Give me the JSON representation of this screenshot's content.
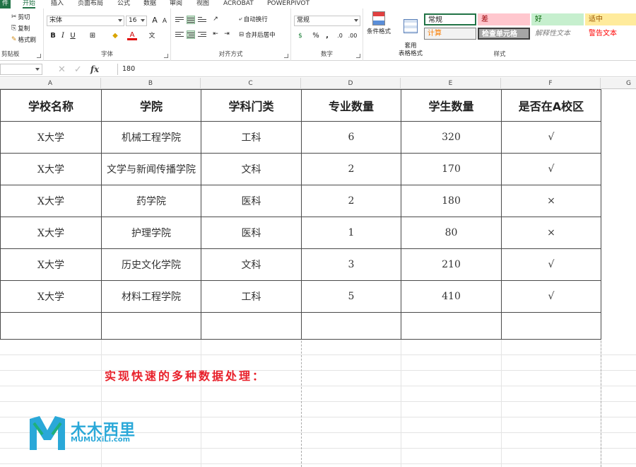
{
  "tabs": [
    "件",
    "开始",
    "插入",
    "页面布局",
    "公式",
    "数据",
    "审阅",
    "视图",
    "ACROBAT",
    "POWERPIVOT"
  ],
  "clipboard": {
    "cut": "剪切",
    "copy": "复制",
    "painter": "格式刷",
    "label": "剪贴板"
  },
  "font": {
    "name": "宋体",
    "size": "16",
    "label": "字体",
    "bold": "B",
    "italic": "I",
    "underline": "U"
  },
  "alignment": {
    "wrap": "自动换行",
    "merge": "合并后居中",
    "label": "对齐方式"
  },
  "number": {
    "format": "常规",
    "percent": "%",
    "comma": ",",
    "label": "数字"
  },
  "styles": {
    "conditional": "条件格式",
    "table": "套用\n表格格式",
    "normal": "常规",
    "bad": "差",
    "good": "好",
    "neutral": "适中",
    "calc": "计算",
    "check": "检查单元格",
    "explain": "解释性文本",
    "warn": "警告文本",
    "label": "样式"
  },
  "formula_bar": {
    "name_box": "",
    "fx": "fx",
    "value": "180"
  },
  "columns": [
    "A",
    "B",
    "C",
    "D",
    "E",
    "F",
    "G"
  ],
  "table": {
    "headers": [
      "学校名称",
      "学院",
      "学科门类",
      "专业数量",
      "学生数量",
      "是否在A校区"
    ],
    "rows": [
      [
        "X大学",
        "机械工程学院",
        "工科",
        "6",
        "320",
        "√"
      ],
      [
        "X大学",
        "文学与新闻传播学院",
        "文科",
        "2",
        "170",
        "√"
      ],
      [
        "X大学",
        "药学院",
        "医科",
        "2",
        "180",
        "×"
      ],
      [
        "X大学",
        "护理学院",
        "医科",
        "1",
        "80",
        "×"
      ],
      [
        "X大学",
        "历史文化学院",
        "文科",
        "3",
        "210",
        "√"
      ],
      [
        "X大学",
        "材料工程学院",
        "工科",
        "5",
        "410",
        "√"
      ],
      [
        "",
        "",
        "",
        "",
        "",
        ""
      ]
    ]
  },
  "caption": "实现快速的多种数据处理：",
  "logo": {
    "cn": "木木西里",
    "en": "MUMUXiLi.com"
  },
  "colors": {
    "accent": "#217346",
    "caption": "#e8202a",
    "logo": "#2aa8d8"
  }
}
